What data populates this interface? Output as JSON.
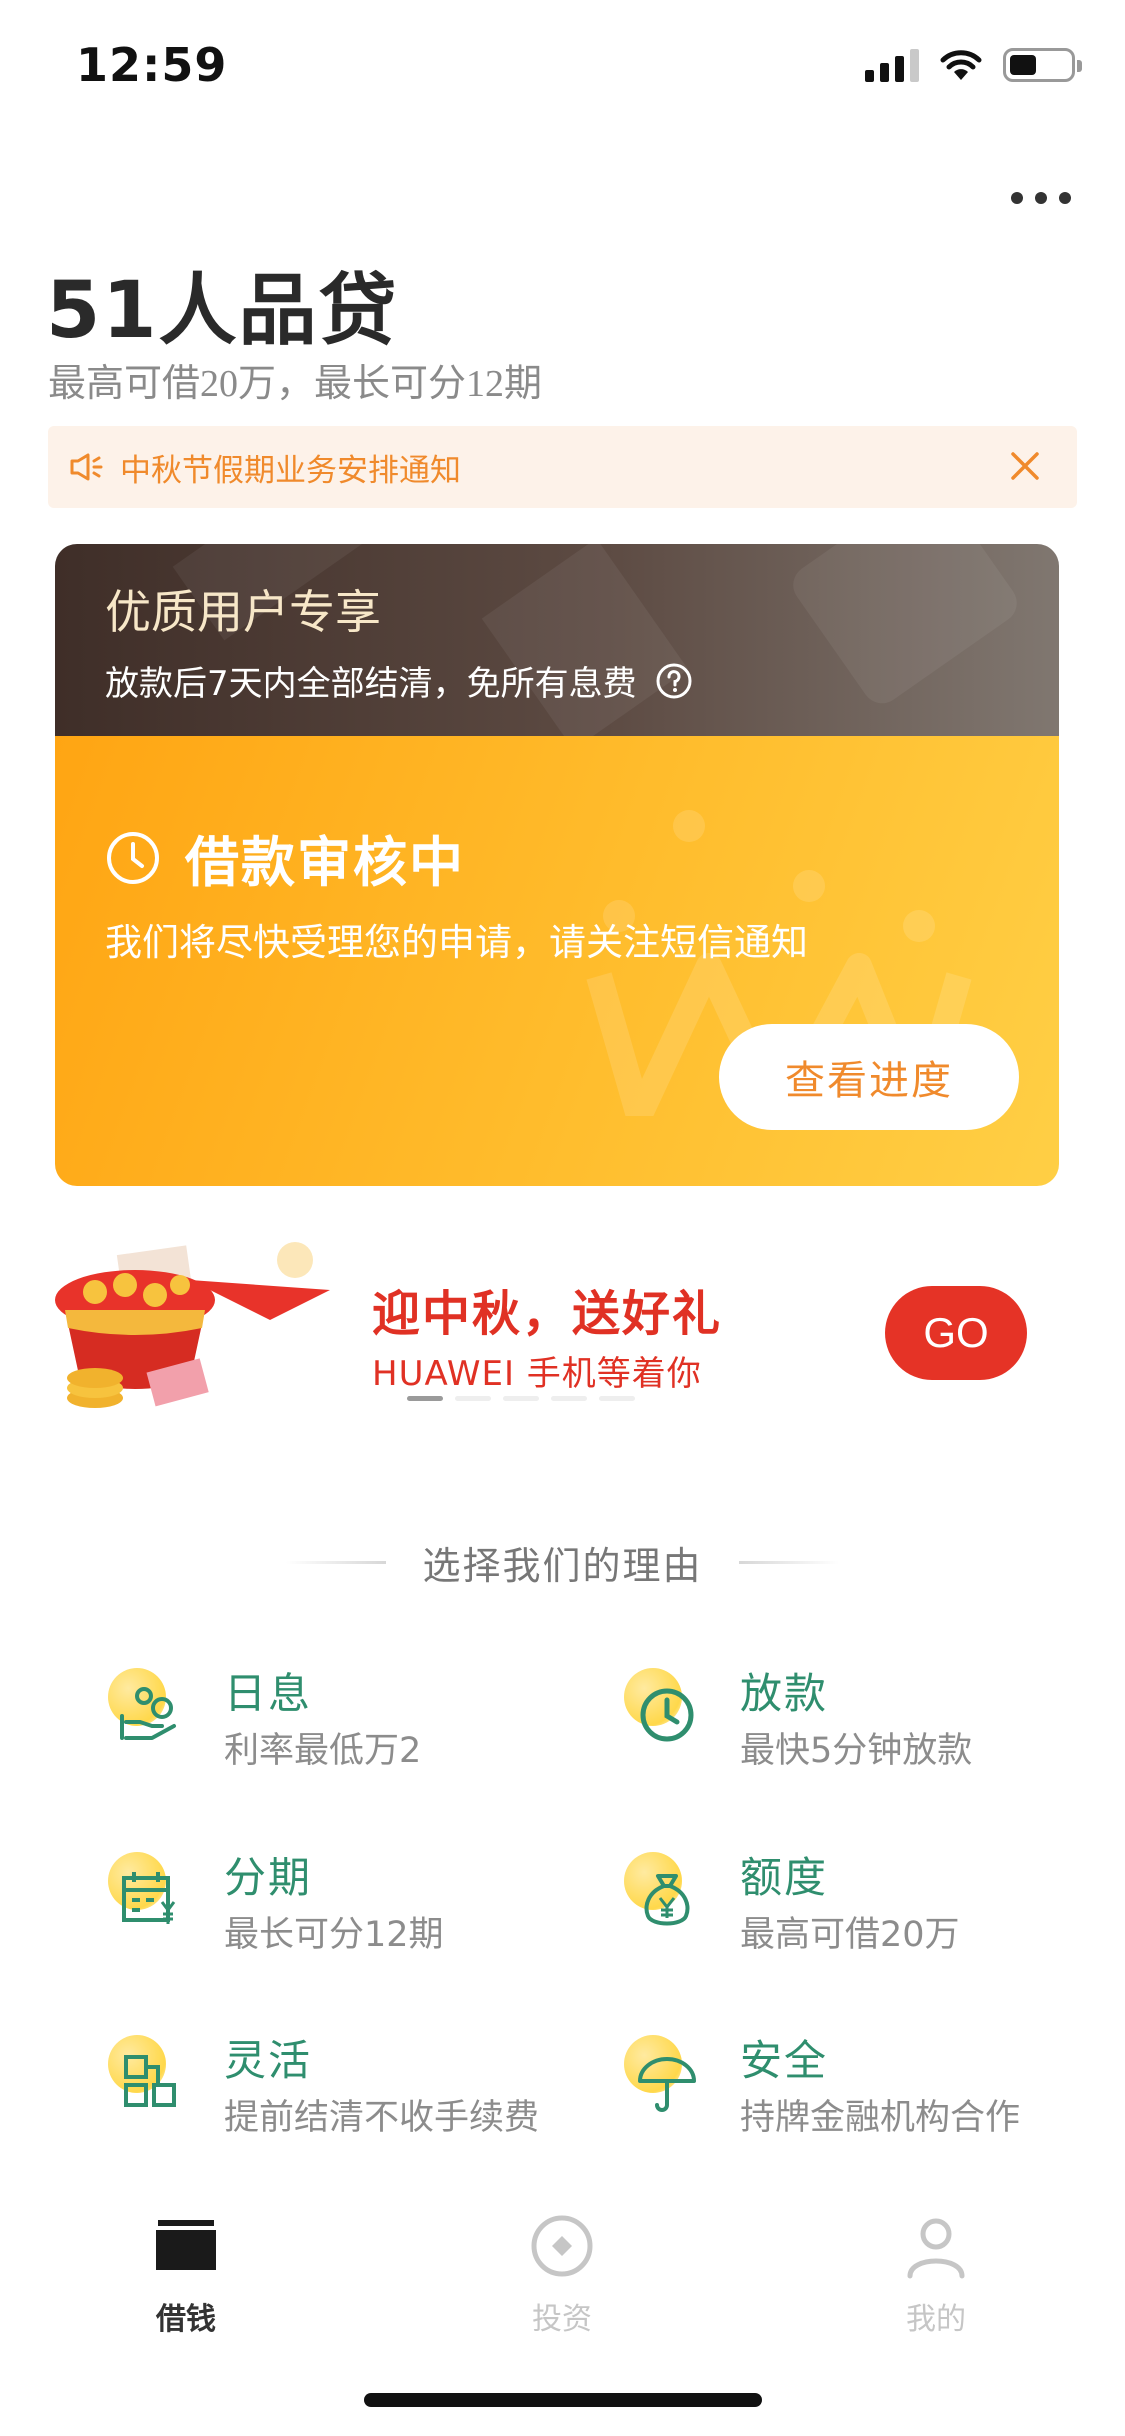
{
  "status_bar": {
    "time": "12:59"
  },
  "header": {
    "title": "51人品贷",
    "subtitle": "最高可借20万，最长可分12期"
  },
  "notice": {
    "text": "中秋节假期业务安排通知"
  },
  "promo_card": {
    "top_title": "优质用户专享",
    "top_subtitle": "放款后7天内全部结清，免所有息费",
    "status_title": "借款审核中",
    "status_desc": "我们将尽快受理您的申请，请关注短信通知",
    "button_label": "查看进度"
  },
  "banner": {
    "title": "迎中秋，送好礼",
    "subtitle": "HUAWEI 手机等着你",
    "go_label": "GO",
    "page_count": 5,
    "active_page": 1
  },
  "reasons": {
    "heading": "选择我们的理由",
    "items": [
      {
        "title": "日息",
        "desc": "利率最低万2",
        "icon": "interest-hand-icon"
      },
      {
        "title": "放款",
        "desc": "最快5分钟放款",
        "icon": "clock-icon"
      },
      {
        "title": "分期",
        "desc": "最长可分12期",
        "icon": "calendar-yen-icon"
      },
      {
        "title": "额度",
        "desc": "最高可借20万",
        "icon": "money-bag-icon"
      },
      {
        "title": "灵活",
        "desc": "提前结清不收手续费",
        "icon": "blocks-icon"
      },
      {
        "title": "安全",
        "desc": "持牌金融机构合作",
        "icon": "umbrella-icon"
      }
    ]
  },
  "tab_bar": {
    "tabs": [
      {
        "label": "借钱",
        "active": true
      },
      {
        "label": "投资",
        "active": false
      },
      {
        "label": "我的",
        "active": false
      }
    ]
  },
  "colors": {
    "accent_orange": "#ffa513",
    "notice_text": "#f08a2c",
    "banner_red": "#e03124",
    "feature_green": "#2f8e6e"
  }
}
